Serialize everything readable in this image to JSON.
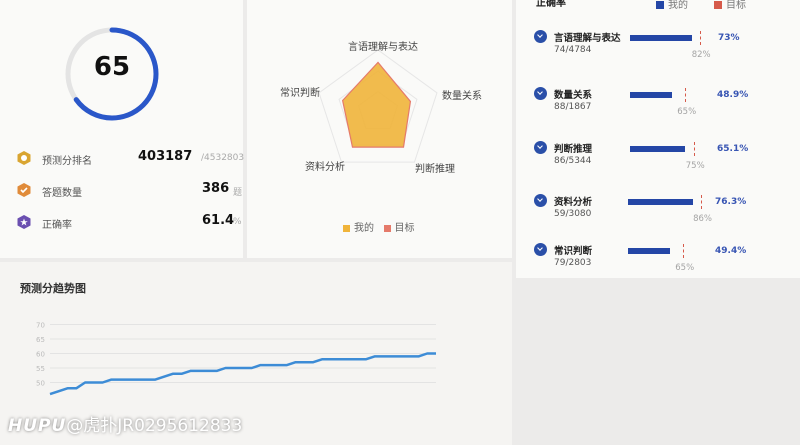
{
  "score": {
    "value": "65",
    "fraction": 0.65
  },
  "stats": [
    {
      "label": "预测分排名",
      "value": "403187",
      "sub": "/4532803",
      "icon": "rank-badge-icon",
      "color": "#d9a531"
    },
    {
      "label": "答题数量",
      "value": "386",
      "sub": "题",
      "icon": "count-badge-icon",
      "color": "#e08b3a"
    },
    {
      "label": "正确率",
      "value": "61.4",
      "sub": "%",
      "icon": "accuracy-badge-icon",
      "color": "#6a4fb0"
    }
  ],
  "radar": {
    "axes": [
      "言语理解与表达",
      "数量关系",
      "判断推理",
      "资料分析",
      "常识判断"
    ],
    "mine": [
      0.8,
      0.55,
      0.7,
      0.7,
      0.6
    ],
    "legend_mine": "我的",
    "legend_target": "目标",
    "color_mine": "#f0b43a",
    "color_target": "#e57a6a"
  },
  "accuracy": {
    "title": "正确率",
    "legend_mine": "我的",
    "legend_target": "目标",
    "rows": [
      {
        "name": "言语理解与表达",
        "count": "74/4784",
        "value": 0.73,
        "pct": "73%",
        "target": 0.82,
        "target_label": "82%"
      },
      {
        "name": "数量关系",
        "count": "88/1867",
        "value": 0.489,
        "pct": "48.9%",
        "target": 0.65,
        "target_label": "65%"
      },
      {
        "name": "判断推理",
        "count": "86/5344",
        "value": 0.651,
        "pct": "65.1%",
        "target": 0.75,
        "target_label": "75%"
      },
      {
        "name": "资料分析",
        "count": "59/3080",
        "value": 0.763,
        "pct": "76.3%",
        "target": 0.86,
        "target_label": "86%"
      },
      {
        "name": "常识判断",
        "count": "79/2803",
        "value": 0.494,
        "pct": "49.4%",
        "target": 0.65,
        "target_label": "65%"
      }
    ]
  },
  "trend": {
    "title": "预测分趋势图",
    "y_ticks": [
      "70",
      "65",
      "60",
      "55",
      "50"
    ],
    "ylim": [
      45,
      75
    ],
    "values": [
      46,
      47,
      48,
      48,
      50,
      50,
      50,
      51,
      51,
      51,
      51,
      51,
      51,
      52,
      53,
      53,
      54,
      54,
      54,
      54,
      55,
      55,
      55,
      55,
      56,
      56,
      56,
      56,
      57,
      57,
      57,
      58,
      58,
      58,
      58,
      58,
      58,
      59,
      59,
      59,
      59,
      59,
      59,
      60,
      60
    ]
  },
  "watermark": {
    "brand": "HUPU",
    "text": "@虎扑JR0295612833"
  }
}
